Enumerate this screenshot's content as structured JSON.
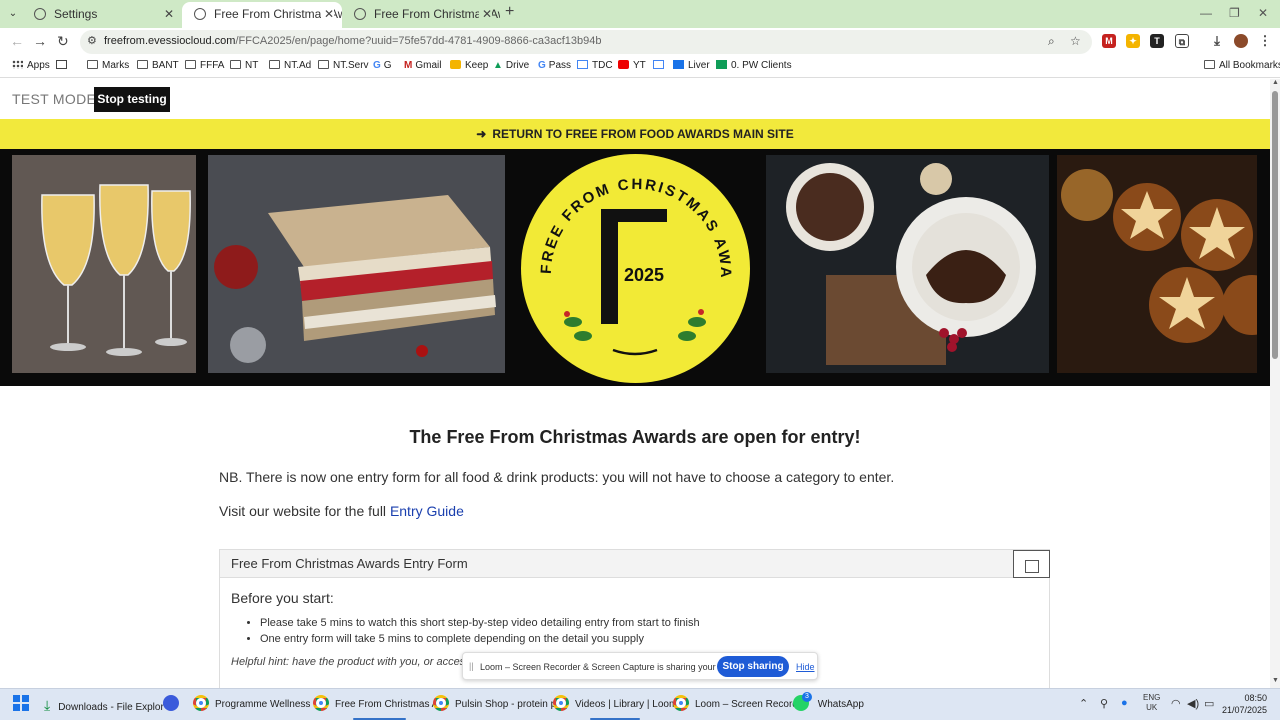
{
  "browser": {
    "tabs": [
      {
        "title": "Settings",
        "active": false
      },
      {
        "title": "Free From Christmas Awards 20",
        "active": true
      },
      {
        "title": "Free From Christmas Awards 20",
        "active": false
      }
    ],
    "url_host": "freefrom.evessiocloud.com",
    "url_path": "/FFCA2025/en/page/home?uuid=75fe57dd-4781-4909-8866-ca3acf13b94b",
    "bookmarks": [
      {
        "label": "Apps",
        "icon": "apps-grid-icon"
      },
      {
        "label": "Marks",
        "icon": "folder-icon"
      },
      {
        "label": "BANT",
        "icon": "folder-icon"
      },
      {
        "label": "FFFA",
        "icon": "folder-icon"
      },
      {
        "label": "NT",
        "icon": "folder-icon"
      },
      {
        "label": "NT.Ad",
        "icon": "folder-icon"
      },
      {
        "label": "NT.Serv",
        "icon": "folder-icon"
      },
      {
        "label": "G",
        "icon": "google-icon"
      },
      {
        "label": "Gmail",
        "icon": "gmail-icon"
      },
      {
        "label": "Keep",
        "icon": "keep-icon"
      },
      {
        "label": "Drive",
        "icon": "drive-icon"
      },
      {
        "label": "Pass",
        "icon": "google-icon"
      },
      {
        "label": "TDC",
        "icon": "calendar-icon"
      },
      {
        "label": "YT",
        "icon": "youtube-icon"
      },
      {
        "label": "Liver",
        "icon": "sheet-icon"
      },
      {
        "label": "0. PW Clients",
        "icon": "sheets-icon"
      }
    ],
    "all_bookmarks": "All Bookmarks"
  },
  "page": {
    "test_mode_label": "TEST MODE",
    "stop_testing": "Stop testing",
    "return_link": "RETURN TO FREE FROM FOOD AWARDS MAIN SITE",
    "logo_text": "FREE FROM CHRISTMAS AWARDS",
    "logo_letter": "F",
    "logo_year": "2025",
    "headline": "The Free From Christmas Awards are open for entry!",
    "note": "NB. There is now one entry form for all food & drink products: you will not have to choose a category to enter.",
    "visit_prefix": "Visit our website for the full",
    "visit_link": "Entry Guide",
    "form_title": "Free From Christmas Awards Entry Form",
    "before_title": "Before you start:",
    "bullets": [
      "Please take 5 mins to watch this short step-by-step video detailing entry from start to finish",
      "One entry form will take 5 mins to complete depending on the detail you supply"
    ],
    "hint": "Helpful hint: have the product with you, or acces"
  },
  "loom": {
    "message": "Loom – Screen Recorder & Screen Capture is sharing your screen.",
    "stop": "Stop sharing",
    "hide": "Hide"
  },
  "taskbar": {
    "items": [
      {
        "label": "Downloads - File Explor"
      },
      {
        "label": ""
      },
      {
        "label": "Programme Wellness M"
      },
      {
        "label": "Free From Christmas Aw"
      },
      {
        "label": "Pulsin Shop - protein pc"
      },
      {
        "label": "Videos | Library | Loom"
      },
      {
        "label": "Loom – Screen Recorde"
      },
      {
        "label": "WhatsApp"
      }
    ],
    "whatsapp_badge": "3",
    "lang1": "ENG",
    "lang2": "UK",
    "time": "08:50",
    "date": "21/07/2025"
  },
  "colors": {
    "yellow": "#f2e93c",
    "stop_sharing_blue": "#1e5bd6",
    "link_blue": "#1a3fae"
  }
}
